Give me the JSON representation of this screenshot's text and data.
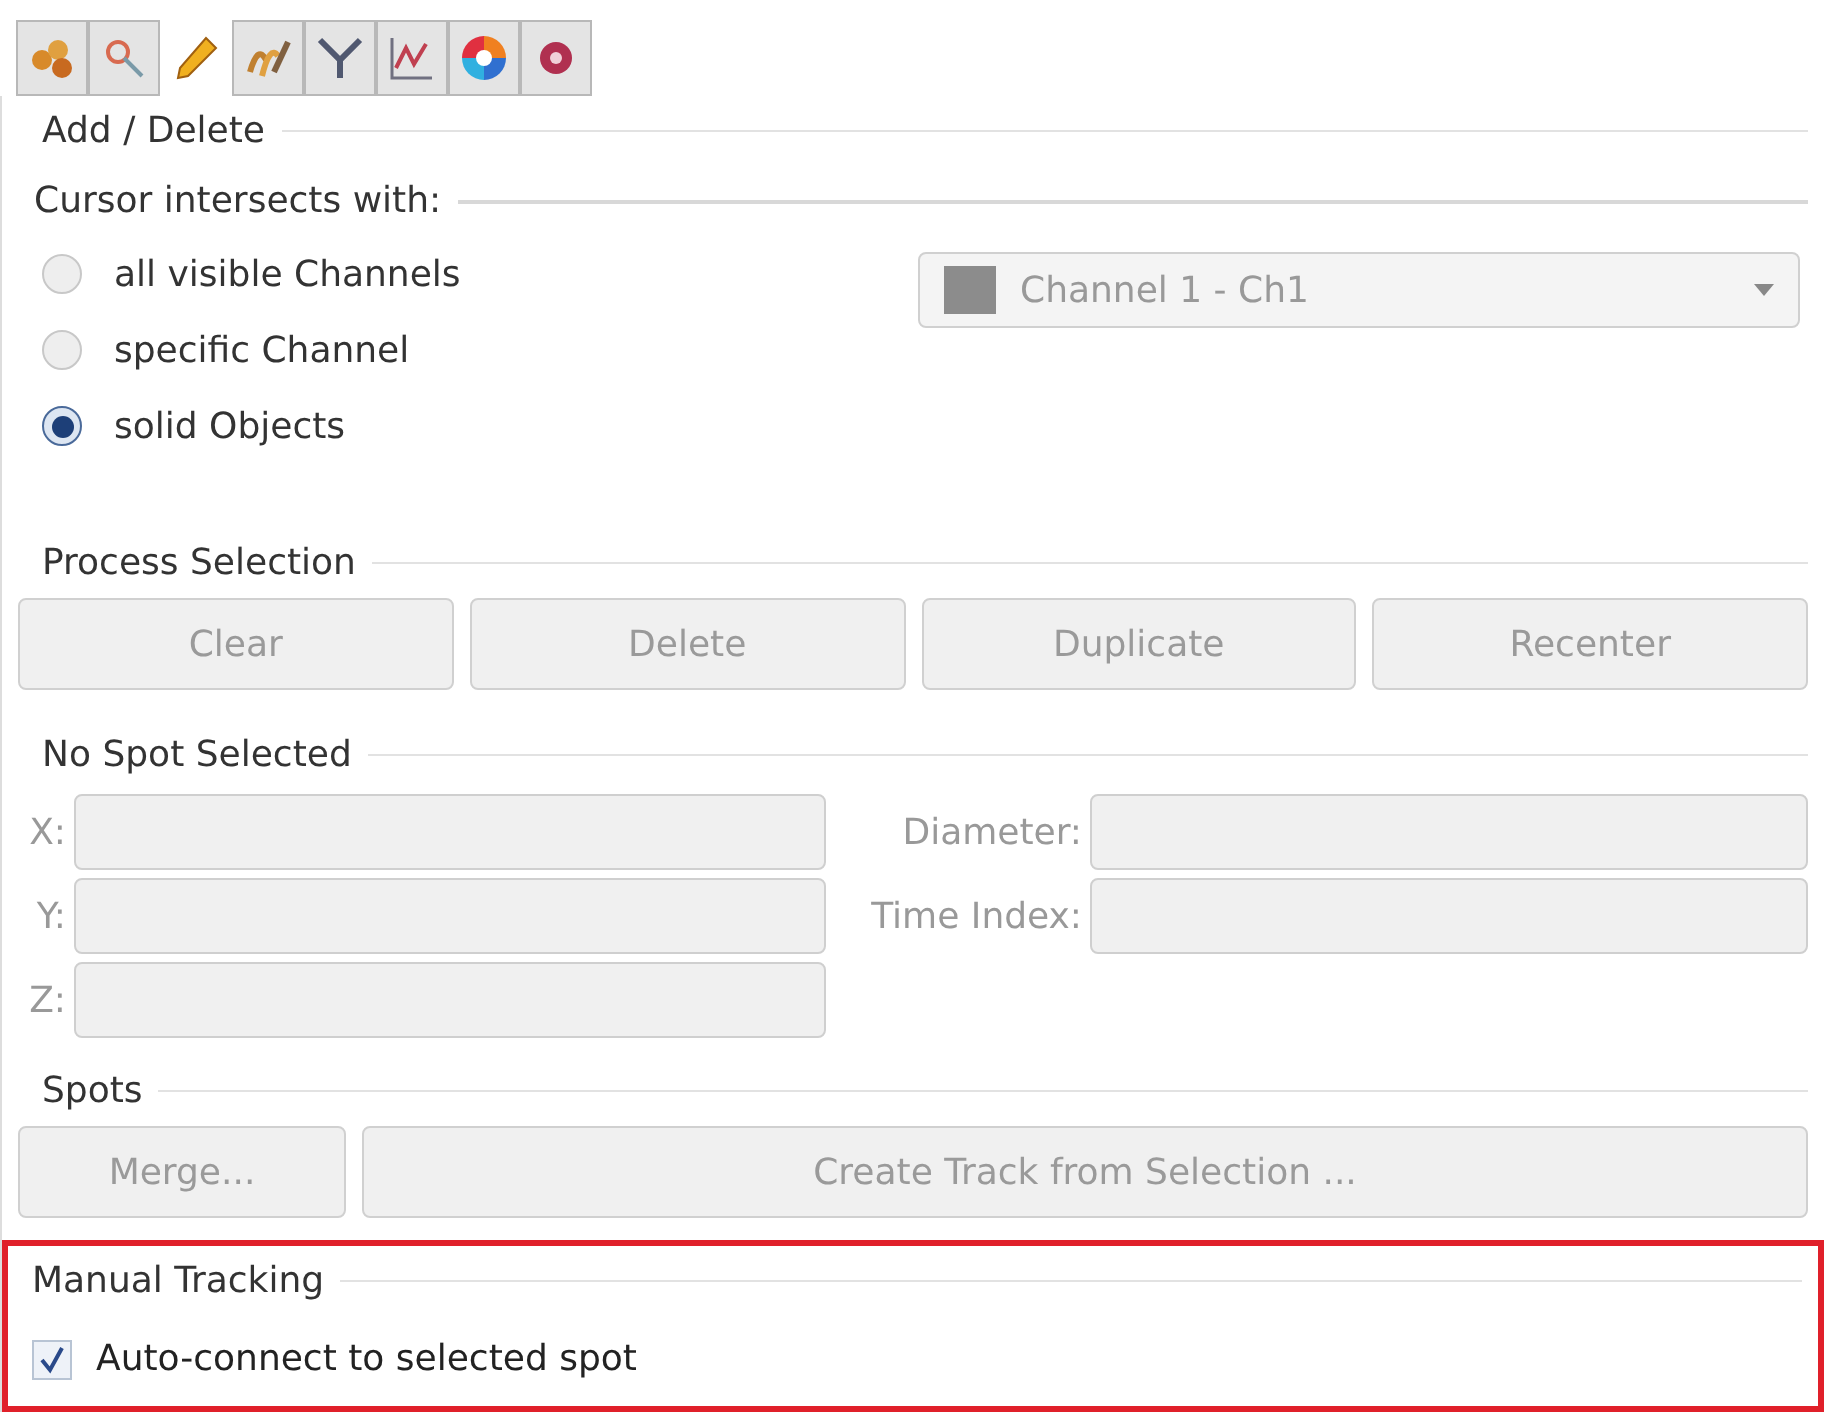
{
  "tabs": [
    {
      "selected": false
    },
    {
      "selected": false
    },
    {
      "selected": true
    },
    {
      "selected": false
    },
    {
      "selected": false
    },
    {
      "selected": false
    },
    {
      "selected": false
    },
    {
      "selected": false
    }
  ],
  "add_delete": {
    "title": "Add / Delete",
    "cursor_label": "Cursor intersects with:",
    "options": [
      {
        "label": "all visible Channels",
        "selected": false
      },
      {
        "label": "specific Channel",
        "selected": false
      },
      {
        "label": "solid Objects",
        "selected": true
      }
    ],
    "channel_dropdown": {
      "value": "Channel 1 - Ch1",
      "color": "#8c8c8c",
      "disabled": true
    }
  },
  "process_selection": {
    "title": "Process Selection",
    "buttons": [
      {
        "label": "Clear",
        "disabled": true
      },
      {
        "label": "Delete",
        "disabled": true
      },
      {
        "label": "Duplicate",
        "disabled": true
      },
      {
        "label": "Recenter",
        "disabled": true
      }
    ]
  },
  "spot_info": {
    "title": "No Spot Selected",
    "fields_left": [
      {
        "label": "X:",
        "disabled": true
      },
      {
        "label": "Y:",
        "disabled": true
      },
      {
        "label": "Z:",
        "disabled": true
      }
    ],
    "fields_right": [
      {
        "label": "Diameter:",
        "disabled": true
      },
      {
        "label": "Time Index:",
        "disabled": true
      }
    ]
  },
  "spots": {
    "title": "Spots",
    "buttons": [
      {
        "label": "Merge...",
        "disabled": true
      },
      {
        "label": "Create Track from Selection ...",
        "disabled": true
      }
    ]
  },
  "manual_tracking": {
    "title": "Manual Tracking",
    "highlighted": true,
    "checkbox": {
      "label": "Auto-connect to selected spot",
      "checked": true
    }
  }
}
